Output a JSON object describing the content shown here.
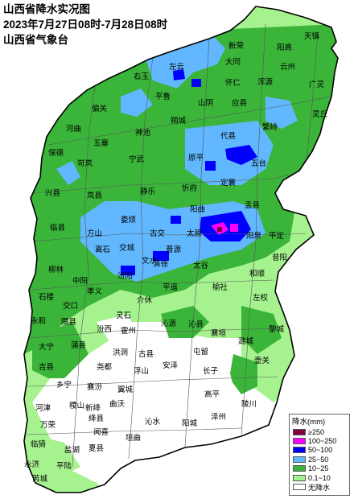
{
  "title_lines": [
    "山西省降水实况图",
    "2023年7月27日08时-7月28日08时",
    "山西省气象台"
  ],
  "legend": {
    "title": "降水(mm)",
    "items": [
      {
        "label": "≥250",
        "color": "#800040"
      },
      {
        "label": "100~250",
        "color": "#ff00ff"
      },
      {
        "label": "50~100",
        "color": "#0000ff"
      },
      {
        "label": "25~50",
        "color": "#61b8ff"
      },
      {
        "label": "10~25",
        "color": "#3ab53a"
      },
      {
        "label": "0.1~10",
        "color": "#a6f28f"
      },
      {
        "label": "无降水",
        "color": "#ffffff"
      }
    ]
  },
  "counties": [
    "天镇",
    "新荣",
    "阳高",
    "左云",
    "大同",
    "广灵",
    "右玉",
    "浑源",
    "云州",
    "怀仁",
    "广灵",
    "平鲁",
    "山阴",
    "应县",
    "繁峙",
    "灵丘",
    "朔城",
    "偏关",
    "河曲",
    "神池",
    "朔州",
    "代县",
    "五台",
    "保德",
    "五寨",
    "宁武",
    "原平",
    "定襄",
    "岢岚",
    "静乐",
    "忻府",
    "盂县",
    "兴县",
    "岚县",
    "阳曲",
    "娄烦",
    "平定",
    "临县",
    "古交",
    "太原",
    "阳泉",
    "方山",
    "离石",
    "昔阳",
    "晋源",
    "交城",
    "清徐",
    "和顺",
    "柳林",
    "汾阳",
    "文水",
    "太谷",
    "中阳",
    "孝义",
    "平遥",
    "榆社",
    "石楼",
    "交口",
    "介休",
    "灵石",
    "左权",
    "永和",
    "隰县",
    "汾西",
    "霍州",
    "沁源",
    "沁县",
    "黎城",
    "大宁",
    "蒲县",
    "洪洞",
    "古县",
    "襄垣",
    "潞城",
    "吉县",
    "尧都",
    "浮山",
    "安泽",
    "长子",
    "壶关",
    "乡宁",
    "襄汾",
    "翼城",
    "屯留",
    "高平",
    "陵川",
    "河津",
    "稷山",
    "新绛",
    "曲沃",
    "绛县",
    "沁水",
    "阳城",
    "泽州",
    "万荣",
    "闻喜",
    "垣曲",
    "芮城",
    "临猗",
    "盐湖",
    "夏县",
    "永济",
    "平陆",
    "芮城"
  ]
}
